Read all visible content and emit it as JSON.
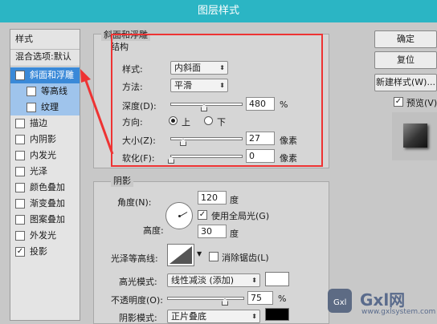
{
  "window": {
    "title": "图层样式"
  },
  "colors": {
    "titlebar": "#2bb5c4",
    "selection": "#3a89d8",
    "subselection": "#9fc4ec",
    "annotation": "#e33333"
  },
  "sidebar": {
    "header": "样式",
    "blend_options": "混合选项:默认",
    "items": [
      {
        "label": "斜面和浮雕",
        "checked": true,
        "selected": true
      },
      {
        "label": "等高线",
        "checked": false,
        "sub": true
      },
      {
        "label": "纹理",
        "checked": false,
        "sub": true
      },
      {
        "label": "描边",
        "checked": false
      },
      {
        "label": "内阴影",
        "checked": false
      },
      {
        "label": "内发光",
        "checked": false
      },
      {
        "label": "光泽",
        "checked": false
      },
      {
        "label": "颜色叠加",
        "checked": false
      },
      {
        "label": "渐变叠加",
        "checked": false
      },
      {
        "label": "图案叠加",
        "checked": false
      },
      {
        "label": "外发光",
        "checked": false
      },
      {
        "label": "投影",
        "checked": true
      }
    ]
  },
  "bevel": {
    "group_title": "斜面和浮雕",
    "structure_title": "结构",
    "style_label": "样式:",
    "style_value": "内斜面",
    "technique_label": "方法:",
    "technique_value": "平滑",
    "depth_label": "深度(D):",
    "depth_value": "480",
    "depth_unit": "%",
    "direction_label": "方向:",
    "direction_up": "上",
    "direction_down": "下",
    "direction_selected": "上",
    "size_label": "大小(Z):",
    "size_value": "27",
    "size_unit": "像素",
    "soften_label": "软化(F):",
    "soften_value": "0",
    "soften_unit": "像素"
  },
  "shading": {
    "title": "阴影",
    "angle_label": "角度(N):",
    "angle_value": "120",
    "angle_unit": "度",
    "global_light_label": "使用全局光(G)",
    "global_light_checked": true,
    "altitude_label": "高度:",
    "altitude_value": "30",
    "altitude_unit": "度",
    "gloss_label": "光泽等高线:",
    "antialias_label": "消除锯齿(L)",
    "highlight_mode_label": "高光模式:",
    "highlight_mode_value": "线性减淡 (添加)",
    "highlight_opacity_label": "不透明度(O):",
    "highlight_opacity_value": "75",
    "highlight_opacity_unit": "%",
    "shadow_mode_label": "阴影模式:",
    "shadow_mode_value": "正片叠底"
  },
  "buttons": {
    "ok": "确定",
    "reset": "复位",
    "new_style": "新建样式(W)...",
    "preview_label": "预览(V)",
    "preview_checked": true
  },
  "watermark": {
    "brand": "Gxl网",
    "url": "www.gxlsystem.com"
  }
}
